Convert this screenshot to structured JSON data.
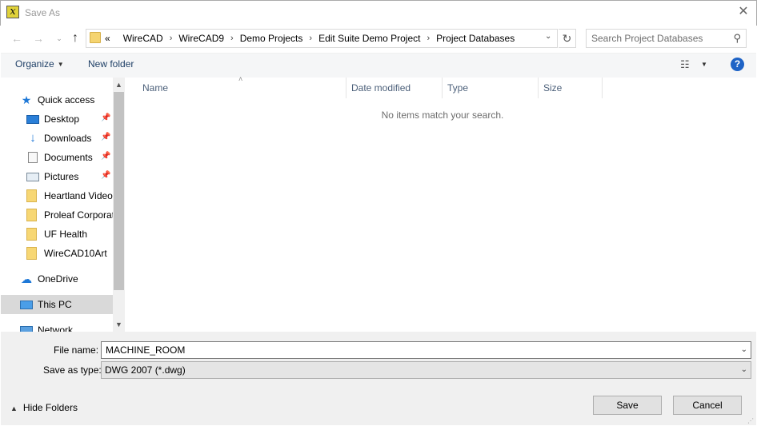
{
  "window": {
    "title": "Save As",
    "app_icon_glyph": "x",
    "close_glyph": "✕"
  },
  "nav": {
    "back_glyph": "←",
    "forward_glyph": "→",
    "recent_glyph": "⌄",
    "up_glyph": "↑"
  },
  "address": {
    "overflow": "«",
    "crumbs": [
      "WireCAD",
      "WireCAD9",
      "Demo Projects",
      "Edit Suite Demo Project",
      "Project Databases"
    ],
    "separator": "›",
    "dropdown_glyph": "⌄",
    "refresh_glyph": "↻"
  },
  "search": {
    "placeholder": "Search Project Databases",
    "icon_glyph": "⚲"
  },
  "toolbar": {
    "organize_label": "Organize",
    "organize_arrow": "▼",
    "new_folder_label": "New folder",
    "view_glyph": "☷",
    "view_arrow": "▼",
    "help_glyph": "?"
  },
  "sidebar": {
    "items": [
      {
        "label": "Quick access",
        "icon": "star-icon",
        "glyph": "★",
        "level": 0,
        "pinned": false
      },
      {
        "label": "Desktop",
        "icon": "desktop-icon",
        "glyph": "",
        "level": 1,
        "pinned": true
      },
      {
        "label": "Downloads",
        "icon": "download-icon",
        "glyph": "↓",
        "level": 1,
        "pinned": true
      },
      {
        "label": "Documents",
        "icon": "document-icon",
        "glyph": "",
        "level": 1,
        "pinned": true
      },
      {
        "label": "Pictures",
        "icon": "picture-icon",
        "glyph": "",
        "level": 1,
        "pinned": true
      },
      {
        "label": "Heartland Video",
        "icon": "folder-icon",
        "glyph": "",
        "level": 1,
        "pinned": false
      },
      {
        "label": "Proleaf Corporat",
        "icon": "folder-icon",
        "glyph": "",
        "level": 1,
        "pinned": false
      },
      {
        "label": "UF Health",
        "icon": "folder-icon",
        "glyph": "",
        "level": 1,
        "pinned": false
      },
      {
        "label": "WireCAD10Art",
        "icon": "folder-icon",
        "glyph": "",
        "level": 1,
        "pinned": false
      },
      {
        "label": "OneDrive",
        "icon": "cloud-icon",
        "glyph": "☁",
        "level": 0,
        "pinned": false
      },
      {
        "label": "This PC",
        "icon": "computer-icon",
        "glyph": "",
        "level": 0,
        "pinned": false,
        "selected": true
      },
      {
        "label": "Network",
        "icon": "network-icon",
        "glyph": "",
        "level": 0,
        "pinned": false
      }
    ],
    "pin_glyph": "📌",
    "scroll_up_glyph": "▲",
    "scroll_down_glyph": "▼"
  },
  "filelist": {
    "columns": [
      "Name",
      "Date modified",
      "Type",
      "Size"
    ],
    "sort_caret": "˄",
    "empty_message": "No items match your search."
  },
  "form": {
    "file_name_label": "File name:",
    "file_name_value": "MACHINE_ROOM",
    "save_type_label": "Save as type:",
    "save_type_value": "DWG 2007 (*.dwg)",
    "dropdown_glyph": "⌄"
  },
  "footer": {
    "hide_folders_arrow": "▲",
    "hide_folders_label": "Hide Folders",
    "save_label": "Save",
    "cancel_label": "Cancel",
    "grip_glyph": "⋰"
  },
  "colors": {
    "link_text": "#1e3f66",
    "help_blue": "#1e63c6",
    "accent_blue": "#1e78d7",
    "column_header_text": "#4c607a"
  }
}
